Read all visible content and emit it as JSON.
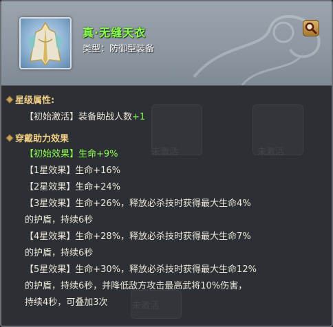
{
  "item": {
    "name": "真·无缝天衣",
    "type": "类型：防御型装备",
    "icon": "armor-robe-icon"
  },
  "header": {
    "search_icon": "magnifier-icon"
  },
  "background": {
    "inactive_label_1": "未激活",
    "inactive_label_2": "未激活",
    "inactive_label_3": "未激活"
  },
  "star_attr": {
    "title": "星级属性:",
    "line_prefix": "【初始激活】装备助战人数",
    "line_value": "+1"
  },
  "assist": {
    "title": "穿戴助力效果",
    "initial_effect": "【初始效果】生命+9%",
    "lines": [
      "【1星效果】生命+16%",
      "【2星效果】生命+24%",
      "【3星效果】生命+26%，释放必杀技时获得最大生命4%",
      "的护盾，持续6秒",
      "【4星效果】生命+28%，释放必杀技时获得最大生命7%",
      "的护盾，持续6秒",
      "【5星效果】生命+30%，释放必杀技时获得最大生命12%",
      "的护盾，持续6秒，并降低敌方攻击最高武将10%伤害，",
      "持续4秒，可叠加3次"
    ]
  },
  "colors": {
    "accent_green": "#8cff52",
    "section_gold": "#f2cf86",
    "body_text": "#ece6da"
  }
}
